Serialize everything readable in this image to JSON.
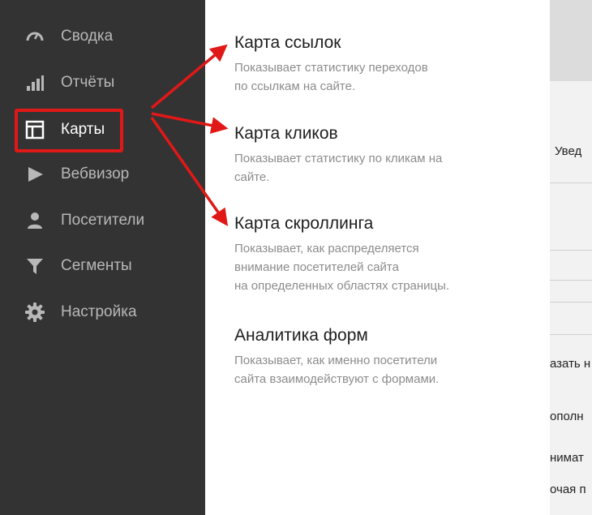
{
  "sidebar": {
    "items": [
      {
        "label": "Сводка",
        "icon": "dashboard-gauge-icon"
      },
      {
        "label": "Отчёты",
        "icon": "bar-chart-icon"
      },
      {
        "label": "Карты",
        "icon": "map-layout-icon",
        "active": true
      },
      {
        "label": "Вебвизор",
        "icon": "play-icon"
      },
      {
        "label": "Посетители",
        "icon": "user-icon"
      },
      {
        "label": "Сегменты",
        "icon": "funnel-icon"
      },
      {
        "label": "Настройка",
        "icon": "gear-icon"
      }
    ]
  },
  "panel": {
    "items": [
      {
        "title": "Карта ссылок",
        "description": "Показывает статистику переходов\nпо ссылкам на сайте."
      },
      {
        "title": "Карта кликов",
        "description": "Показывает статистику по кликам на\nсайте."
      },
      {
        "title": "Карта скроллинга",
        "description": "Показывает, как распределяется\nвнимание посетителей сайта\nна определенных областях страницы."
      },
      {
        "title": "Аналитика форм",
        "description": "Показывает, как именно посетители\nсайта взаимодействуют с формами."
      }
    ]
  },
  "background_page": {
    "fragments": [
      "Увед",
      "азать н",
      "ополн",
      "нимат",
      "очая п"
    ]
  },
  "colors": {
    "sidebar_bg": "#333333",
    "highlight": "#e01818",
    "arrow": "#e01818"
  }
}
